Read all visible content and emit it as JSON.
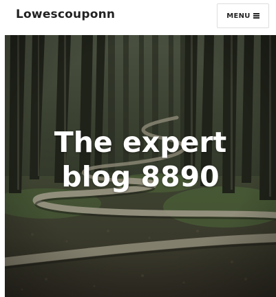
{
  "header": {
    "site_title": "Lowescouponn",
    "menu_label": "MENU",
    "menu_icon": "hamburger-icon"
  },
  "hero": {
    "title_line1": "The expert",
    "title_line2": "blog 8890",
    "image_subject": "forest-path-photo"
  },
  "colors": {
    "header_background": "#ffffff",
    "title_text": "#222222",
    "hero_text": "#ffffff",
    "button_border": "#dddddd"
  }
}
